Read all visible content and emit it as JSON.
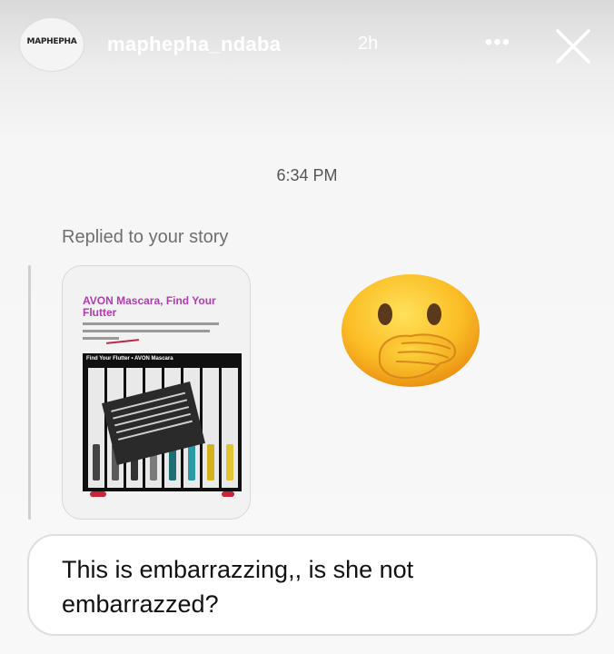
{
  "header": {
    "avatar_text": "MAPHEPHA",
    "username": "maphepha_ndaba",
    "time_ago": "2h",
    "more_icon": "more-horizontal-icon",
    "close_icon": "close-icon"
  },
  "conversation": {
    "timestamp": "6:34 PM",
    "reply_label": "Replied to your story",
    "story_preview": {
      "title": "AVON Mascara, Find Your Flutter",
      "card_title": "Find Your Flutter • AVON Mascara"
    },
    "reaction_emoji": "face-with-hand-over-mouth-emoji",
    "message": "This is embarrazzing,, is she not embarrazzed?"
  }
}
